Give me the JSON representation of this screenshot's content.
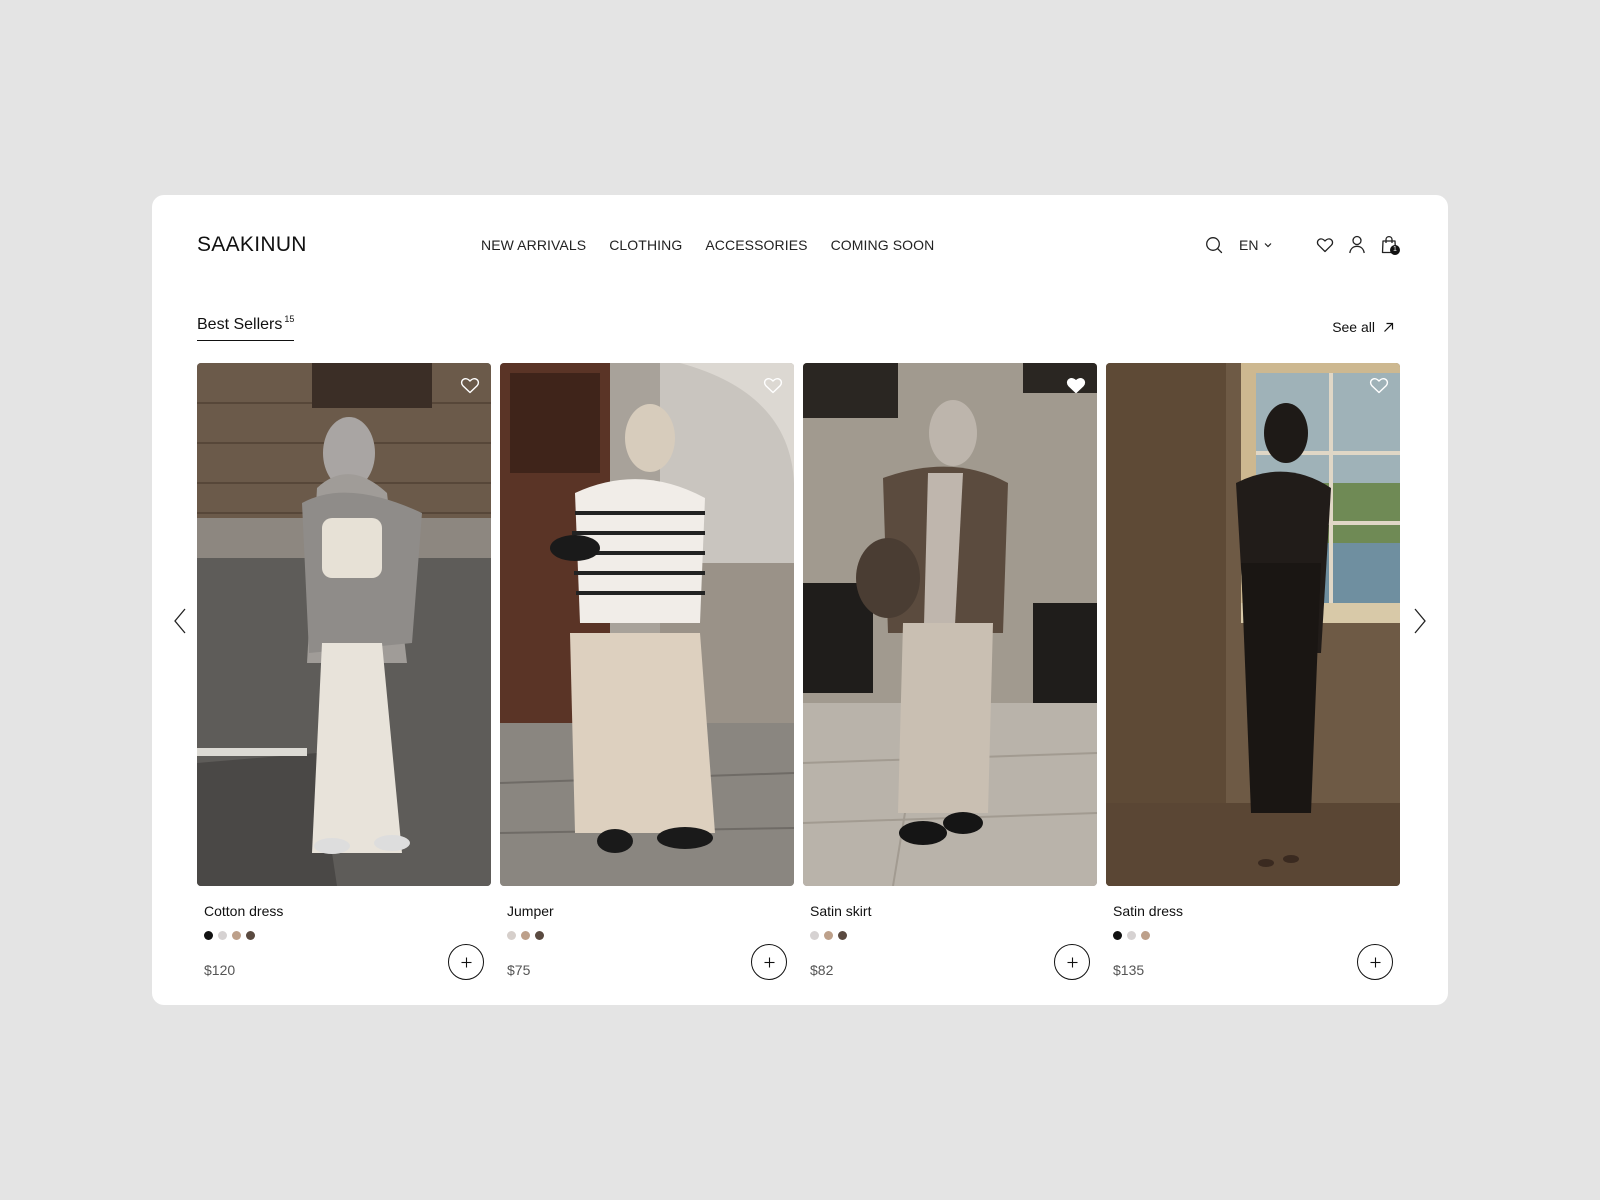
{
  "brand": "SAAKINUN",
  "nav": [
    "NEW ARRIVALS",
    "CLOTHING",
    "ACCESSORIES",
    "COMING SOON"
  ],
  "header": {
    "language": "EN",
    "icons": [
      "search-icon",
      "chevron-down-icon",
      "heart-icon",
      "user-icon",
      "shopping-bag-icon"
    ],
    "cart_count": "1"
  },
  "section": {
    "title": "Best Sellers",
    "count": "15",
    "see_all": "See all"
  },
  "products": [
    {
      "name": "Cotton dress",
      "price": "$120",
      "swatches": [
        "#111111",
        "#d6d2d2",
        "#bda08a",
        "#5a4a40"
      ],
      "favorited": false
    },
    {
      "name": "Jumper",
      "price": "$75",
      "swatches": [
        "#d6cfcb",
        "#bda08a",
        "#5a4a40"
      ],
      "favorited": false
    },
    {
      "name": "Satin skirt",
      "price": "$82",
      "swatches": [
        "#d6d2d2",
        "#bda08a",
        "#5a4a40"
      ],
      "favorited": true
    },
    {
      "name": "Satin dress",
      "price": "$135",
      "swatches": [
        "#111111",
        "#d6d2d2",
        "#bda08a"
      ],
      "favorited": false
    }
  ],
  "colors": {
    "background": "#e4e4e4",
    "card": "#ffffff",
    "text": "#111111",
    "price": "#555555"
  }
}
